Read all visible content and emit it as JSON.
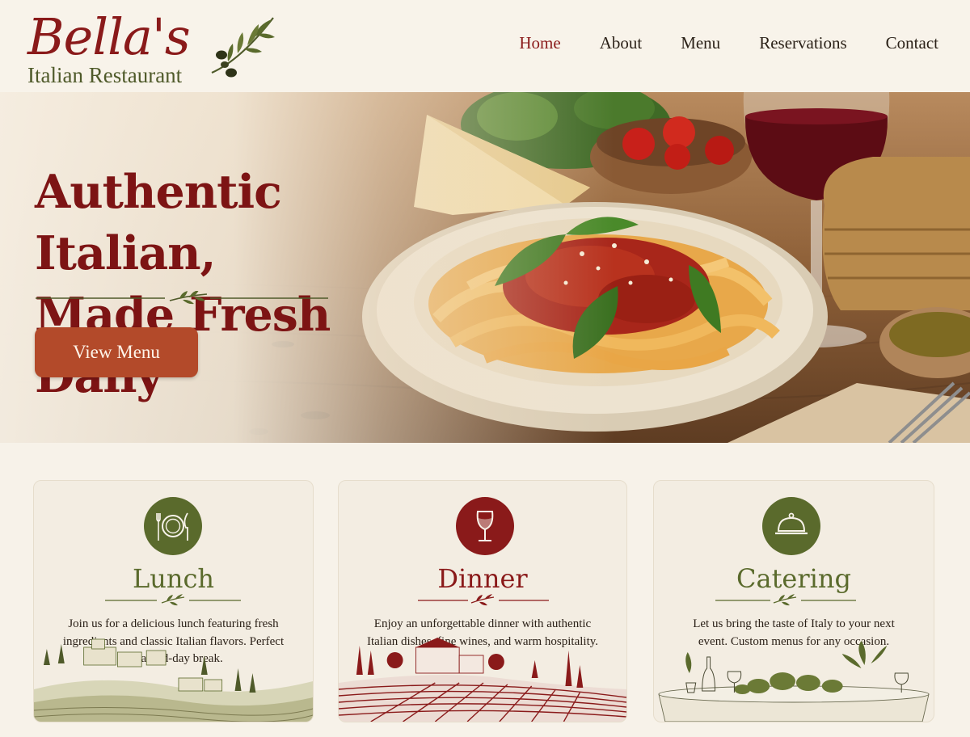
{
  "brand": {
    "name": "Bella's",
    "tagline": "Italian Restaurant"
  },
  "nav": {
    "items": [
      {
        "label": "Home",
        "active": true
      },
      {
        "label": "About",
        "active": false
      },
      {
        "label": "Menu",
        "active": false
      },
      {
        "label": "Reservations",
        "active": false
      },
      {
        "label": "Contact",
        "active": false
      }
    ]
  },
  "hero": {
    "title_line1": "Authentic Italian,",
    "title_line2": "Made Fresh Daily",
    "cta_label": "View Menu"
  },
  "cards": [
    {
      "title": "Lunch",
      "icon": "plate-cutlery-icon",
      "text": "Join us for a delicious lunch featuring fresh ingredients and classic Italian flavors. Perfect for a mid-day break.",
      "color": "#5a6a2c"
    },
    {
      "title": "Dinner",
      "icon": "wine-glass-icon",
      "text": "Enjoy an unforgettable dinner with authentic Italian dishes, fine wines, and warm hospitality.",
      "color": "#8a1a1a"
    },
    {
      "title": "Catering",
      "icon": "cloche-icon",
      "text": "Let us bring the taste of Italy to your next event. Custom menus for any occasion.",
      "color": "#5a6a2c"
    }
  ],
  "colors": {
    "brand_red": "#8a1a1a",
    "olive_green": "#5a6a2c",
    "cta_terracotta": "#b34a2a",
    "background_cream": "#f7f2e9"
  }
}
